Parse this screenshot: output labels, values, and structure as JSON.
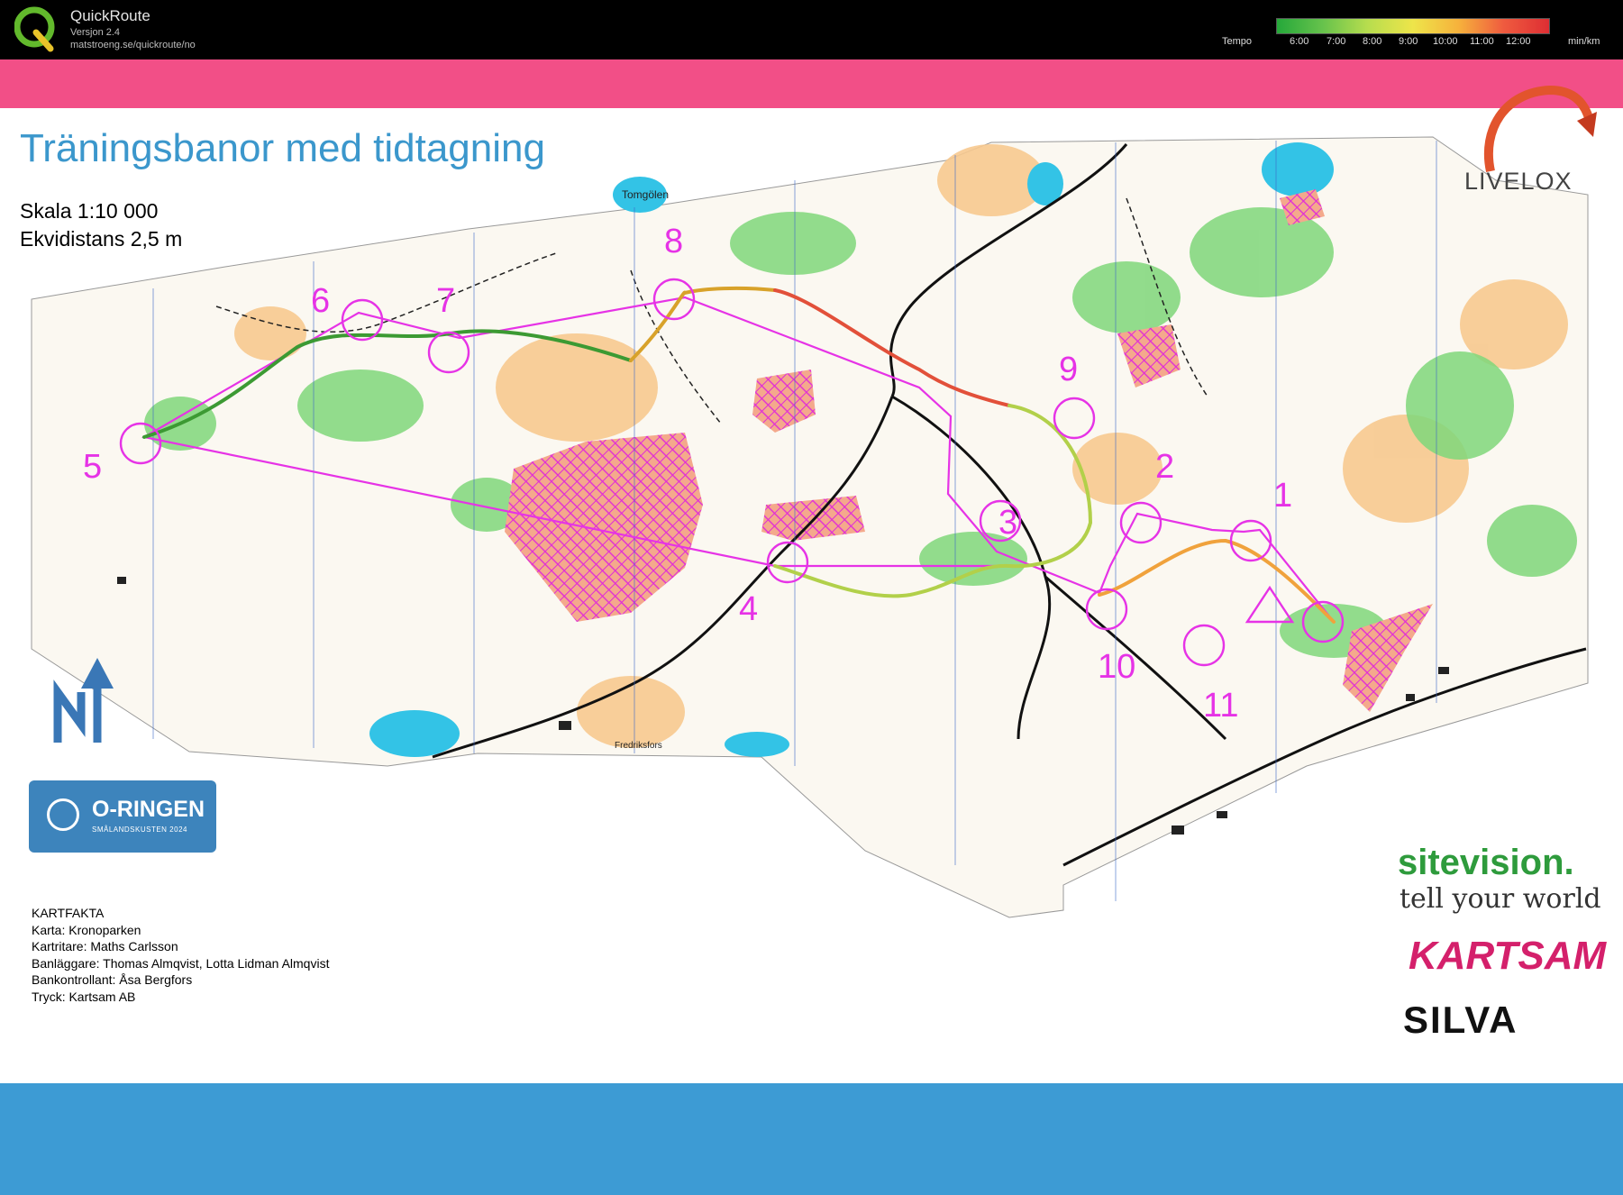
{
  "app": {
    "name": "QuickRoute",
    "version": "Versjon 2.4",
    "url": "matstroeng.se/quickroute/no"
  },
  "tempo_legend": {
    "label": "Tempo",
    "ticks": [
      "6:00",
      "7:00",
      "8:00",
      "9:00",
      "10:00",
      "11:00",
      "12:00"
    ],
    "unit": "min/km",
    "colors": [
      "#25a83a",
      "#66c24c",
      "#b7dd4e",
      "#eee54a",
      "#f6b23c",
      "#ef5b3f",
      "#de2e33"
    ]
  },
  "document": {
    "title": "Träningsbanor med tidtagning",
    "scale": "Skala 1:10 000",
    "equidistance": "Ekvidistans 2,5 m"
  },
  "map": {
    "place_names": [
      "Tomgölen",
      "Fredriksfors"
    ],
    "course_color": "#e633e6",
    "controls": [
      "1",
      "2",
      "3",
      "4",
      "5",
      "6",
      "7",
      "8",
      "9",
      "10",
      "11"
    ]
  },
  "sponsor": {
    "oringen_title": "O-RINGEN",
    "oringen_subtitle": "SMÅLANDSKUSTEN 2024",
    "livelox": "LIVELOX",
    "sitevision": "sitevision.",
    "sitevision_tagline": "tell your world",
    "kartsam": "KARTSAM",
    "silva": "SILVA"
  },
  "map_facts": {
    "heading": "KARTFAKTA",
    "lines": [
      "Karta: Kronoparken",
      "Kartritare: Maths Carlsson",
      "Banläggare: Thomas Almqvist, Lotta Lidman Almqvist",
      "Bankontrollant: Åsa Bergfors",
      "Tryck: Kartsam AB"
    ]
  },
  "colors": {
    "header_bg": "#000000",
    "pink_band": "#f24f87",
    "blue_band": "#3d9bd4",
    "title_blue": "#3b97cc"
  }
}
